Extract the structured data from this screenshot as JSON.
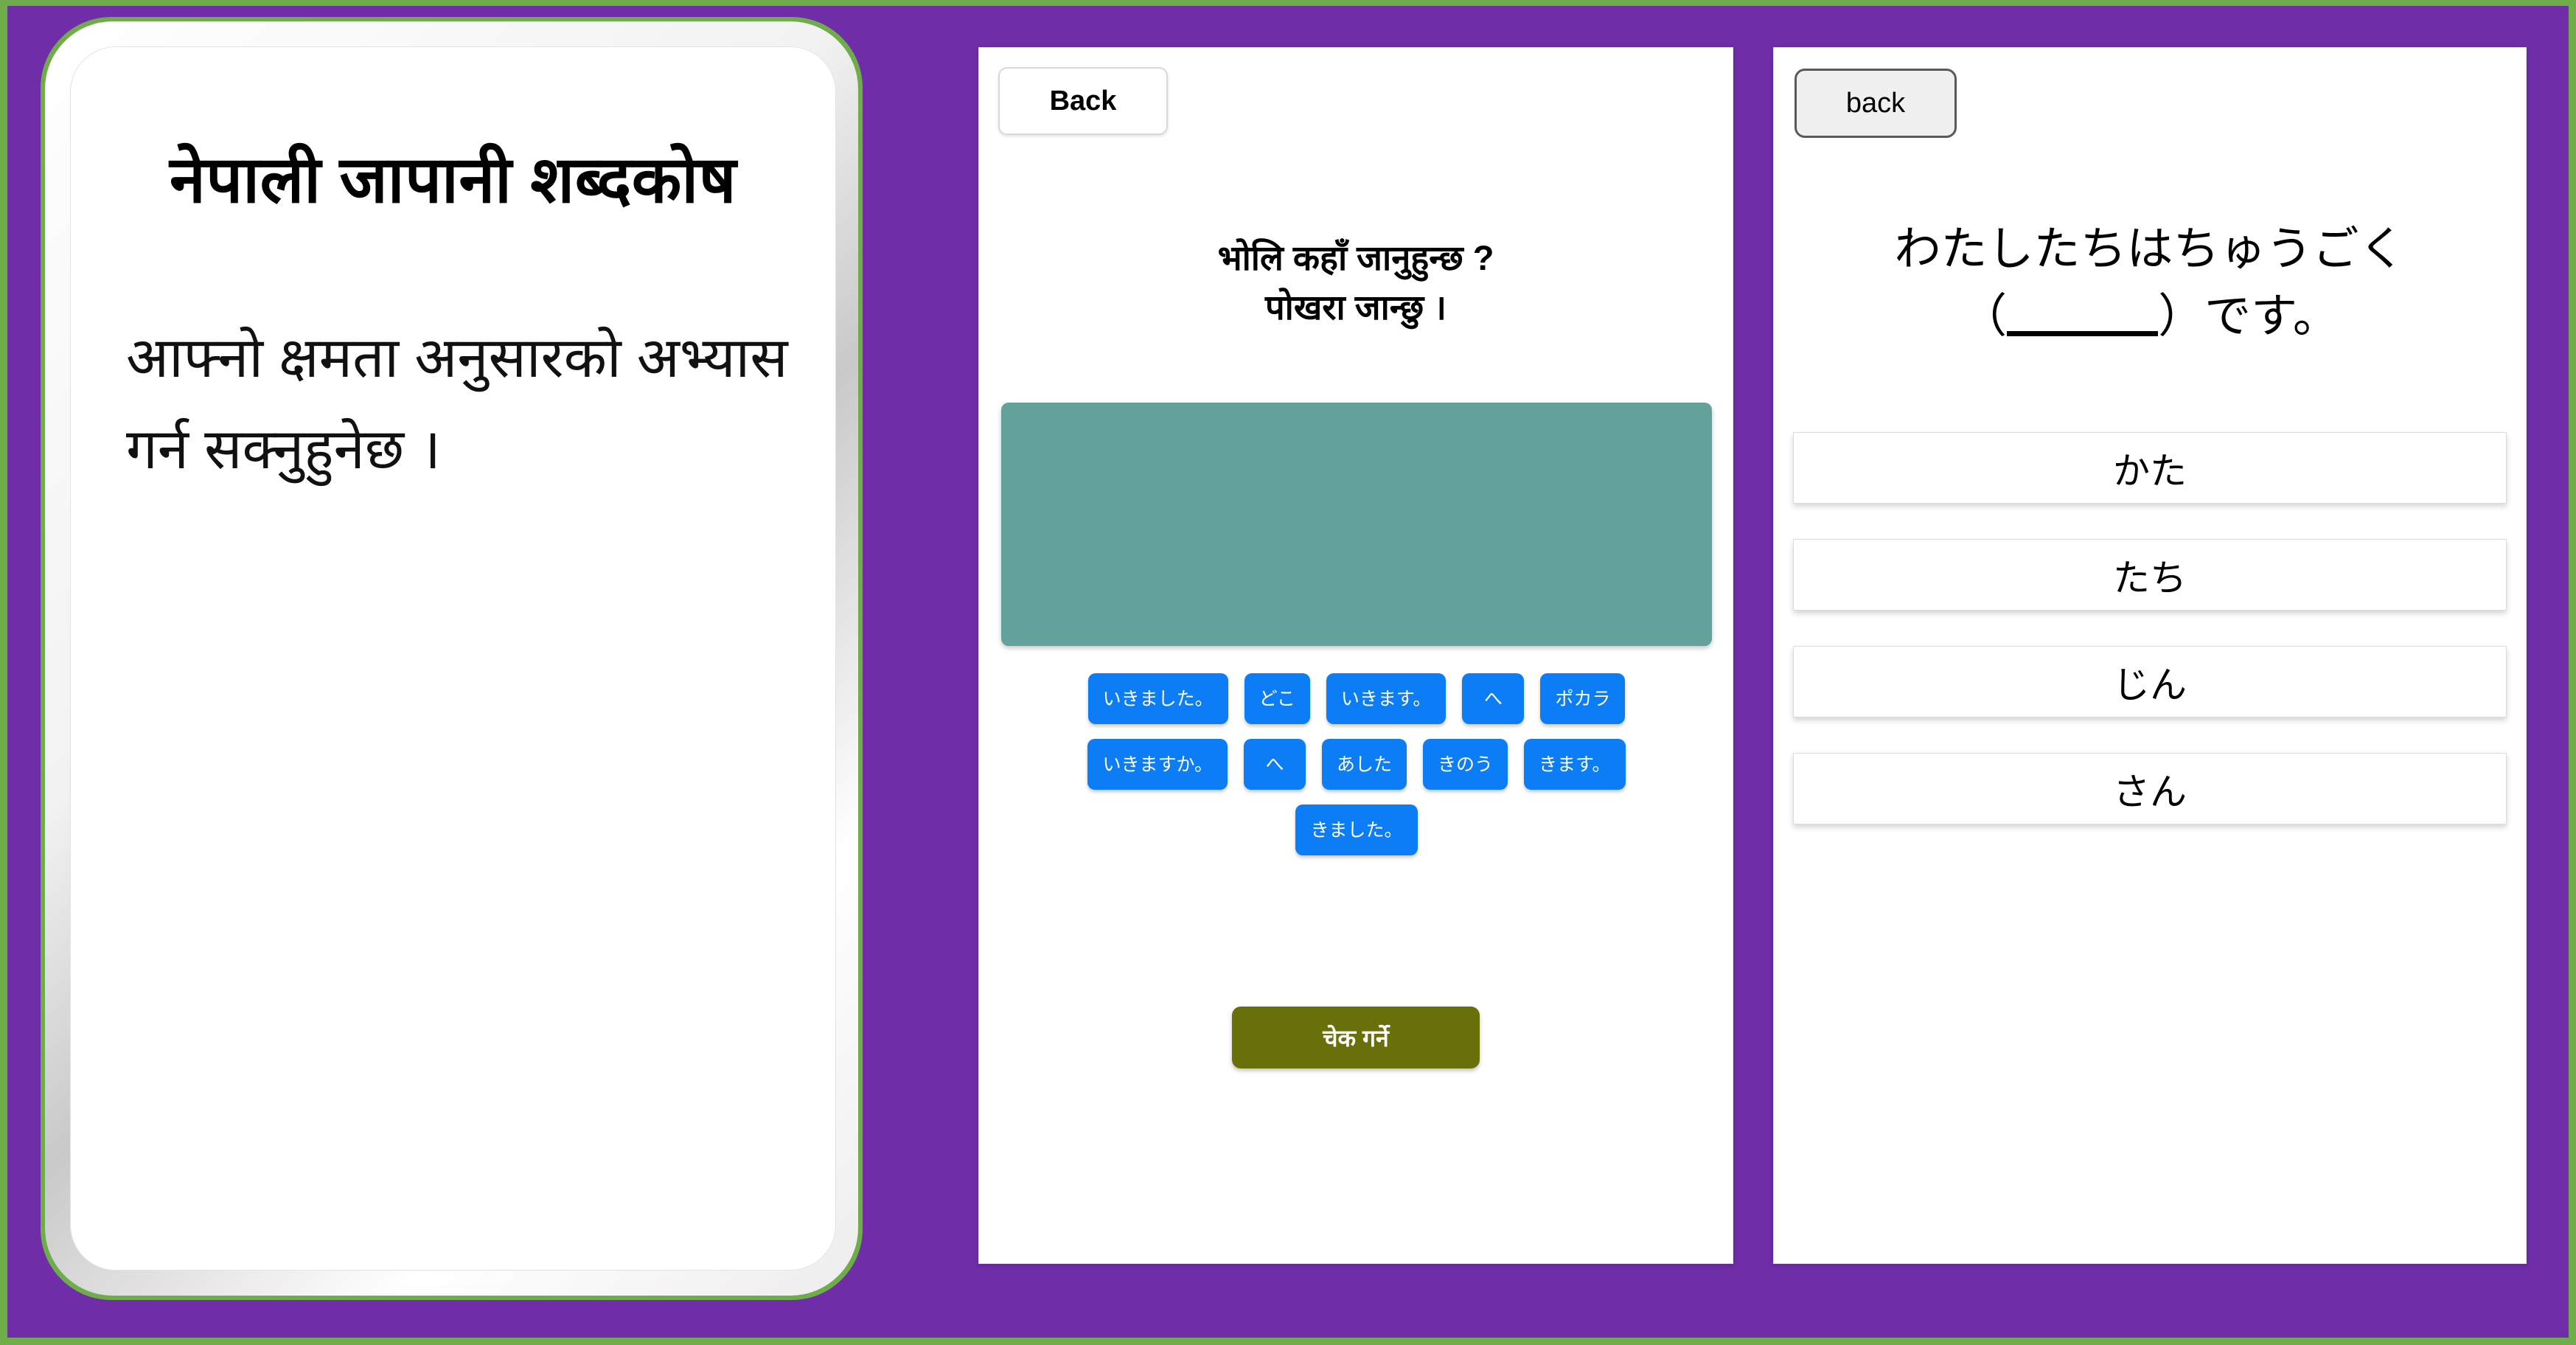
{
  "theme": {
    "frame_green": "#6fad4a",
    "backdrop_purple": "#6F2DA8",
    "chip_blue": "#0d7df5",
    "dropzone_teal": "#63a19d",
    "check_olive": "#6a7009"
  },
  "cover": {
    "title": "नेपाली जापानी शब्दकोष",
    "body": "आफ्नो क्षमता अनुसारको अभ्यास गर्न सक्नुहुनेछ ।"
  },
  "arrange_screen": {
    "back_label": "Back",
    "prompt_line1": "भोलि कहाँ जानुहुन्छ ?",
    "prompt_line2": "पोखरा जान्छु ।",
    "answer_area_text": "",
    "word_rows": [
      [
        "いきました。",
        "どこ",
        "いきます。",
        "へ",
        "ポカラ"
      ],
      [
        "いきますか。",
        "へ",
        "あした",
        "きのう",
        "きます。"
      ],
      [
        "きました。"
      ]
    ],
    "check_label": "चेक गर्ने"
  },
  "choice_screen": {
    "back_label": "back",
    "question_line1": "わたしたちはちゅうごく",
    "question_prefix": "（",
    "question_suffix": "）です。",
    "options": [
      "かた",
      "たち",
      "じん",
      "さん"
    ]
  }
}
